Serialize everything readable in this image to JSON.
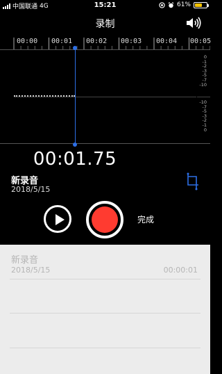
{
  "status_bar": {
    "carrier": "中国联通",
    "network": "4G",
    "time": "15:21",
    "battery": "61%",
    "battery_level": 0.61,
    "icons": [
      "signal-icon",
      "location-icon",
      "alarm-icon",
      "battery-icon"
    ]
  },
  "header": {
    "title": "录制",
    "speaker_icon": "speaker-icon"
  },
  "timeline": {
    "ticks": [
      "00:00",
      "00:01",
      "00:02",
      "00:03",
      "00:04",
      "00:05"
    ],
    "db_top": [
      "0",
      "-1",
      "-2",
      "-3",
      "-5",
      "-7",
      "-10"
    ],
    "db_bottom": [
      "-10",
      "-7",
      "-5",
      "-3",
      "-2",
      "-1",
      "0"
    ],
    "playhead_color": "#2d6fe6"
  },
  "recording": {
    "elapsed": "00:01.75",
    "name": "新录音",
    "date": "2018/5/15",
    "trim_icon": "trim-icon"
  },
  "controls": {
    "play_icon": "play-icon",
    "record_icon": "record-icon",
    "record_color": "#ff3b30",
    "done_label": "完成"
  },
  "list": {
    "items": [
      {
        "name": "新录音",
        "date": "2018/5/15",
        "duration": "00:00:01"
      }
    ]
  }
}
